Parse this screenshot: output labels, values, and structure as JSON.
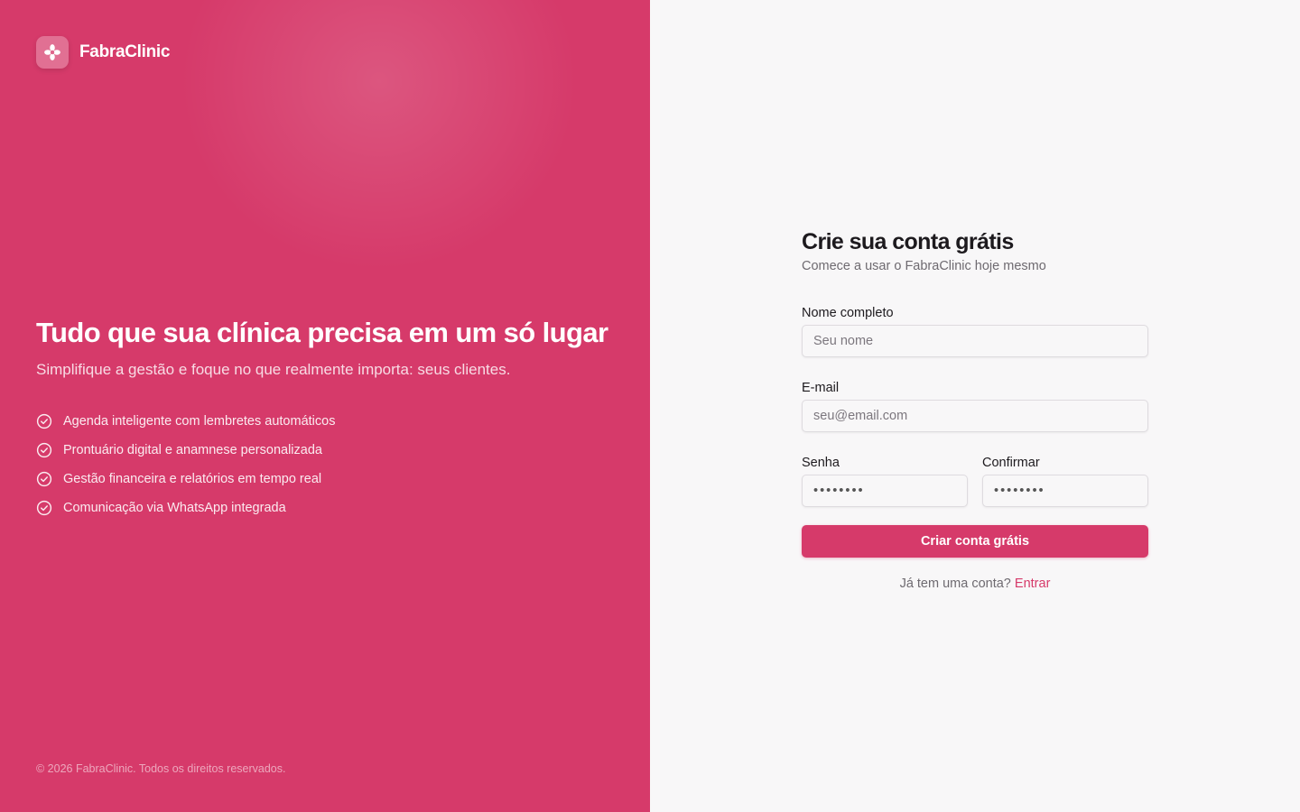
{
  "brand": {
    "name": "FabraClinic",
    "icon": "flower-icon"
  },
  "hero": {
    "title": "Tudo que sua clínica precisa em um só lugar",
    "subtitle": "Simplifique a gestão e foque no que realmente importa: seus clientes.",
    "features": [
      "Agenda inteligente com lembretes automáticos",
      "Prontuário digital e anamnese personalizada",
      "Gestão financeira e relatórios em tempo real",
      "Comunicação via WhatsApp integrada"
    ]
  },
  "footer": {
    "copyright": "© 2026 FabraClinic. Todos os direitos reservados."
  },
  "form": {
    "title": "Crie sua conta grátis",
    "subtitle": "Comece a usar o FabraClinic hoje mesmo",
    "name_label": "Nome completo",
    "name_placeholder": "Seu nome",
    "email_label": "E-mail",
    "email_placeholder": "seu@email.com",
    "password_label": "Senha",
    "password_value": "••••••••",
    "confirm_label": "Confirmar",
    "confirm_value": "••••••••",
    "submit_label": "Criar conta grátis",
    "login_prompt": "Já tem uma conta?",
    "login_link": "Entrar"
  },
  "colors": {
    "brand": "#d63a6a",
    "panel_bg": "#f8f7f8",
    "text_dark": "#1d1a1e",
    "text_muted": "#6e6a70"
  }
}
